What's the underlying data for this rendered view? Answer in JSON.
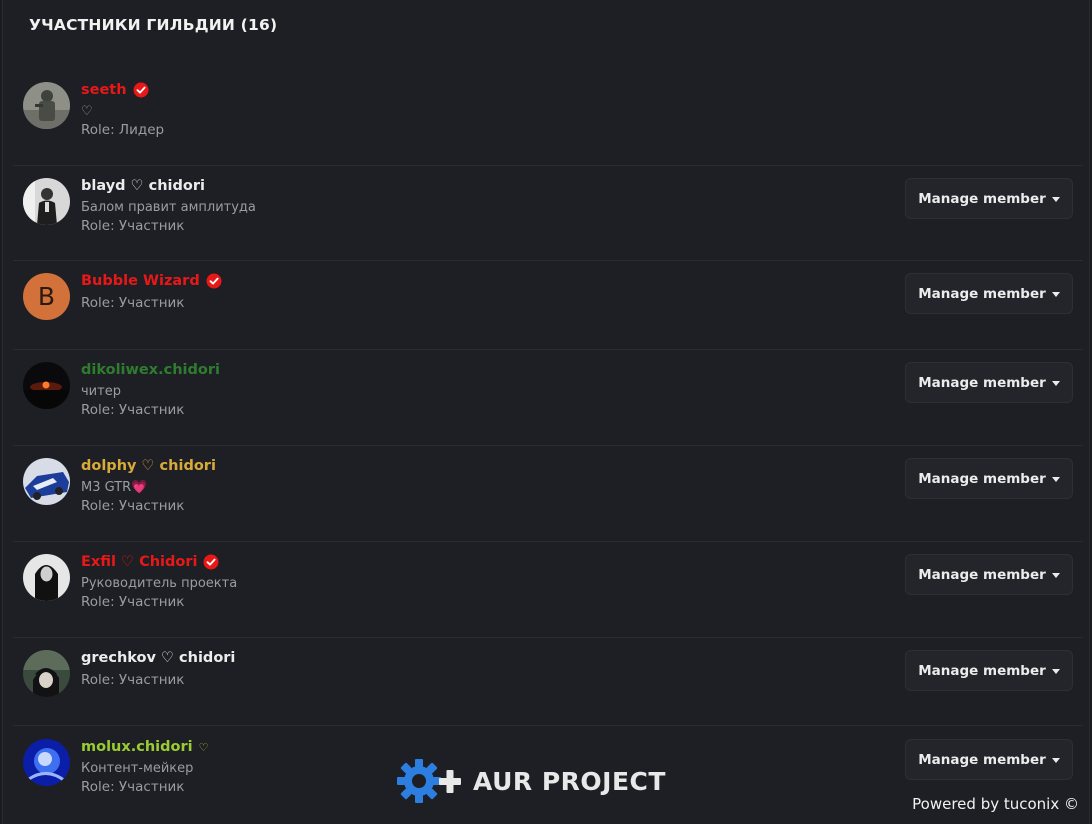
{
  "header": {
    "title": "УЧАСТНИКИ ГИЛЬДИИ (16)"
  },
  "members": [
    {
      "name": "seeth",
      "name_color": "#e81818",
      "verified": true,
      "status": "♡",
      "role": "Role: Лидер",
      "avatar_icon": "soldier-avatar"
    },
    {
      "name": "blayd ♡ chidori",
      "name_color": "#ececec",
      "verified": false,
      "status": "Балом правит амплитуда",
      "role": "Role: Участник",
      "avatar_icon": "suit-man-avatar"
    },
    {
      "name": "Bubble Wizard",
      "name_color": "#e81818",
      "verified": true,
      "status": "",
      "role": "Role: Участник",
      "avatar_icon": "letter-b-avatar",
      "avatar_letter": "B"
    },
    {
      "name": "dikoliwex.chidori",
      "name_color": "#2e7d2e",
      "verified": false,
      "status": "читер",
      "role": "Role: Участник",
      "avatar_icon": "sunset-avatar"
    },
    {
      "name": "dolphy ♡ chidori",
      "name_color": "#d9a93a",
      "verified": false,
      "status": "M3 GTR💗",
      "role": "Role: Участник",
      "avatar_icon": "car-avatar"
    },
    {
      "name": "Exfil ♡ Chidori",
      "name_color": "#e81818",
      "verified": true,
      "status": "Руководитель проекта",
      "role": "Role: Участник",
      "avatar_icon": "woman-portrait-avatar"
    },
    {
      "name": "grechkov ♡ chidori",
      "name_color": "#ececec",
      "verified": false,
      "status": "",
      "role": "Role: Участник",
      "avatar_icon": "anime-avatar"
    },
    {
      "name": "molux.chidori",
      "name_color": "#9acd32",
      "verified": false,
      "heart_badge": "♡",
      "status": "Контент-мейкер",
      "role": "Role: Участник",
      "avatar_icon": "blue-swirl-avatar"
    }
  ],
  "manage_label": "Manage member",
  "watermark": {
    "text": "AUR PROJECT",
    "icon": "gear-plus-icon"
  },
  "footer": {
    "powered": "Powered by tuconix ©"
  }
}
